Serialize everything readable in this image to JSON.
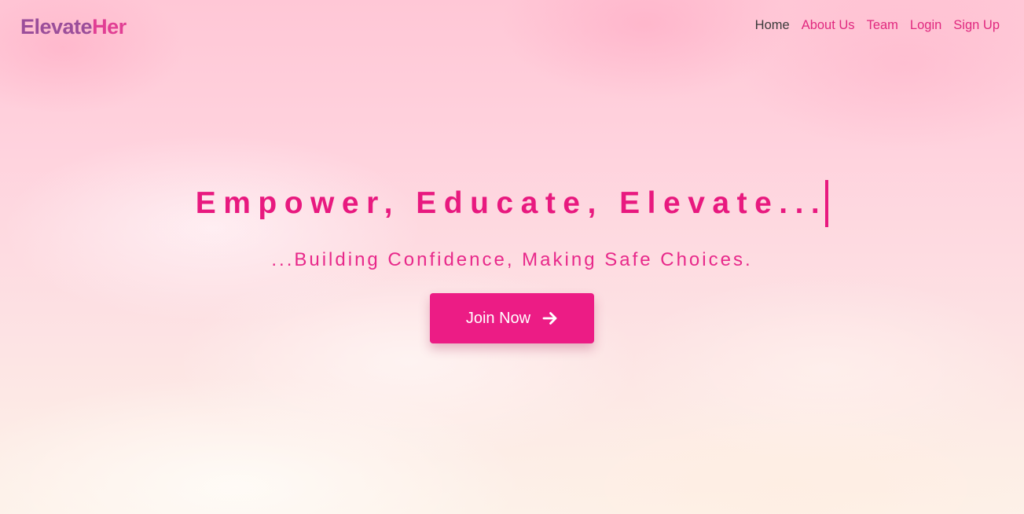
{
  "logo": {
    "part1": "Elevate",
    "part2": "Her"
  },
  "nav": {
    "items": [
      {
        "label": "Home",
        "active": true
      },
      {
        "label": "About Us"
      },
      {
        "label": "Team"
      },
      {
        "label": "Login"
      },
      {
        "label": "Sign Up"
      }
    ]
  },
  "hero": {
    "headline": "Empower, Educate, Elevate...",
    "subheadline": "...Building Confidence, Making Safe Choices.",
    "cta_label": "Join Now",
    "cta_icon": "arrow-right-icon"
  },
  "colors": {
    "primary": "#ec1c85",
    "logo_primary": "#9b4e9a",
    "logo_accent": "#e13f94",
    "nav_active": "#3a3a3a"
  }
}
